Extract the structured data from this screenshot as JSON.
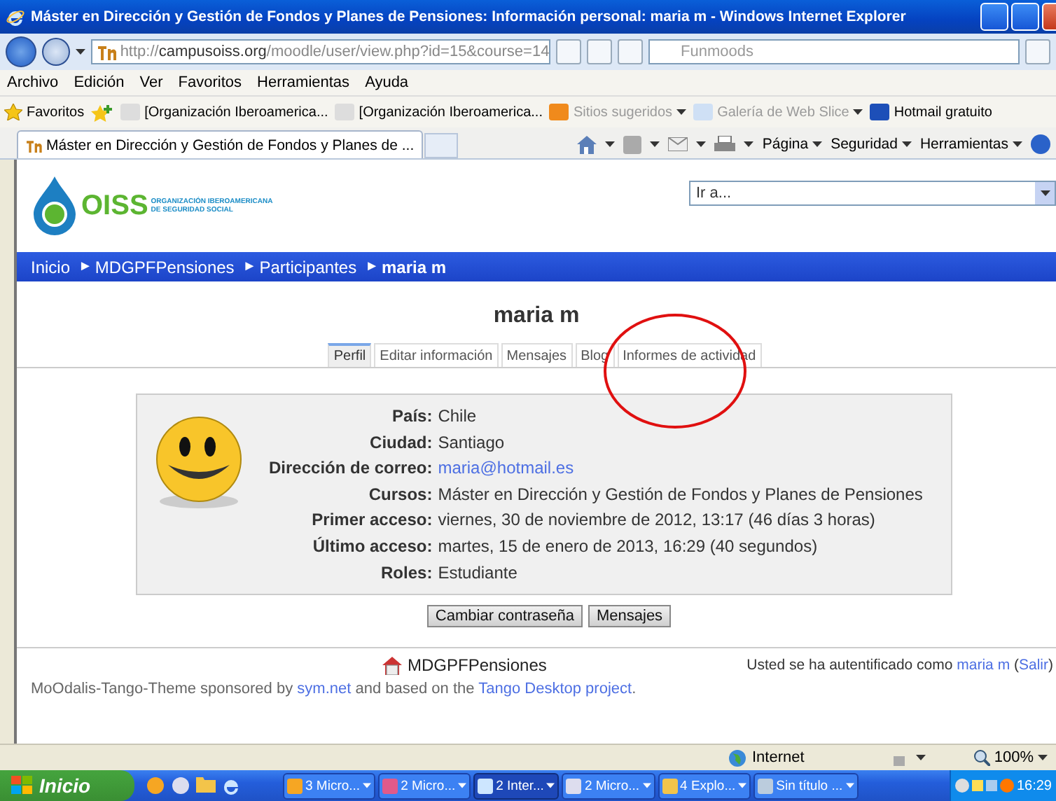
{
  "window": {
    "title": "Máster en Dirección y Gestión de Fondos y Planes de Pensiones: Información personal: maria m - Windows Internet Explorer"
  },
  "address_bar": {
    "url_prefix": "http://",
    "url_host": "campusoiss.org",
    "url_path": "/moodle/user/view.php?id=15&course=14",
    "search_placeholder": "Funmoods"
  },
  "menu": [
    "Archivo",
    "Edición",
    "Ver",
    "Favoritos",
    "Herramientas",
    "Ayuda"
  ],
  "favorites_bar": {
    "label": "Favoritos",
    "items": [
      {
        "label": "[Organización Iberoamerica...",
        "disabled": false,
        "dropdown": false
      },
      {
        "label": "[Organización Iberoamerica...",
        "disabled": false,
        "dropdown": false
      },
      {
        "label": "Sitios sugeridos",
        "disabled": true,
        "dropdown": true
      },
      {
        "label": "Galería de Web Slice",
        "disabled": true,
        "dropdown": true
      },
      {
        "label": "Hotmail gratuito",
        "disabled": false,
        "dropdown": false
      }
    ]
  },
  "browser_tab": {
    "title": "Máster en Dirección y Gestión de Fondos y Planes de ..."
  },
  "command_bar": [
    "Página",
    "Seguridad",
    "Herramientas"
  ],
  "site": {
    "logo_text": "OISS",
    "logo_subtitle": [
      "ORGANIZACIÓN IBEROAMERICANA",
      "DE SEGURIDAD SOCIAL"
    ],
    "jump_select": "Ir a..."
  },
  "breadcrumb": {
    "separator": "►",
    "items": [
      {
        "label": "Inicio",
        "current": false
      },
      {
        "label": "MDGPFPensiones",
        "current": false
      },
      {
        "label": "Participantes",
        "current": false
      },
      {
        "label": "maria m",
        "current": true
      }
    ]
  },
  "profile": {
    "name": "maria m",
    "tabs": [
      {
        "label": "Perfil",
        "selected": true
      },
      {
        "label": "Editar información",
        "selected": false
      },
      {
        "label": "Mensajes",
        "selected": false
      },
      {
        "label": "Blog",
        "selected": false
      },
      {
        "label": "Informes de actividad",
        "selected": false
      }
    ],
    "fields": [
      {
        "label": "País:",
        "value": "Chile",
        "kind": "text"
      },
      {
        "label": "Ciudad:",
        "value": "Santiago",
        "kind": "text"
      },
      {
        "label": "Dirección de correo:",
        "value": "maria@hotmail.es",
        "kind": "link"
      },
      {
        "label": "Cursos:",
        "value": "Máster en Dirección y Gestión de Fondos y Planes de Pensiones",
        "kind": "text"
      },
      {
        "label": "Primer acceso:",
        "value": "viernes, 30 de noviembre de 2012, 13:17  (46 días 3 horas)",
        "kind": "text"
      },
      {
        "label": "Último acceso:",
        "value": "martes, 15 de enero de 2013, 16:29  (40 segundos)",
        "kind": "text"
      },
      {
        "label": "Roles:",
        "value": "Estudiante",
        "kind": "text"
      }
    ],
    "buttons": [
      "Cambiar contraseña",
      "Mensajes"
    ]
  },
  "footer": {
    "home_link": "MDGPFPensiones",
    "login_text": "Usted se ha autentificado como",
    "user_link": "maria m",
    "logout_open": "(",
    "logout_link": "Salir",
    "logout_close": ")",
    "credits": [
      {
        "text": "MoOdalis-Tango-Theme sponsored by ",
        "link": false
      },
      {
        "text": "sym.net",
        "link": true
      },
      {
        "text": " and based on the ",
        "link": false
      },
      {
        "text": "Tango Desktop project",
        "link": true
      },
      {
        "text": ".",
        "link": false
      }
    ]
  },
  "status_bar": {
    "zone": "Internet",
    "zoom": "100%"
  },
  "taskbar": {
    "start": "Inicio",
    "buttons": [
      {
        "label": "3 Micro...",
        "selected": false
      },
      {
        "label": "2 Micro...",
        "selected": false
      },
      {
        "label": "2 Inter...",
        "selected": true
      },
      {
        "label": "2 Micro...",
        "selected": false
      },
      {
        "label": "4 Explo...",
        "selected": false
      },
      {
        "label": "Sin título ...",
        "selected": false
      }
    ],
    "clock": "16:29"
  }
}
